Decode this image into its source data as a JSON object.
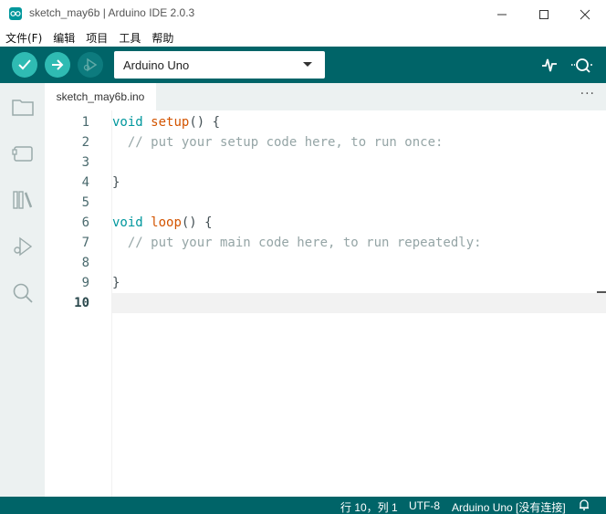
{
  "window": {
    "title": "sketch_may6b | Arduino IDE 2.0.3"
  },
  "menu": [
    "文件(F)",
    "编辑",
    "项目",
    "工具",
    "帮助"
  ],
  "toolbar": {
    "board": "Arduino Uno"
  },
  "editor": {
    "tab": "sketch_may6b.ino",
    "more": "···",
    "lines": [
      {
        "n": "1",
        "parts": [
          [
            "kw",
            "void"
          ],
          [
            "",
            " "
          ],
          [
            "fn",
            "setup"
          ],
          [
            "",
            "() {"
          ]
        ]
      },
      {
        "n": "2",
        "parts": [
          [
            "",
            "  "
          ],
          [
            "cm",
            "// put your setup code here, to run once:"
          ]
        ]
      },
      {
        "n": "3",
        "parts": []
      },
      {
        "n": "4",
        "parts": [
          [
            "",
            "}"
          ]
        ]
      },
      {
        "n": "5",
        "parts": []
      },
      {
        "n": "6",
        "parts": [
          [
            "kw",
            "void"
          ],
          [
            "",
            " "
          ],
          [
            "fn",
            "loop"
          ],
          [
            "",
            "() {"
          ]
        ]
      },
      {
        "n": "7",
        "parts": [
          [
            "",
            "  "
          ],
          [
            "cm",
            "// put your main code here, to run repeatedly:"
          ]
        ]
      },
      {
        "n": "8",
        "parts": []
      },
      {
        "n": "9",
        "parts": [
          [
            "",
            "}"
          ]
        ]
      },
      {
        "n": "10",
        "parts": []
      }
    ],
    "active_line": "10"
  },
  "status": {
    "position": "行 10，列 1",
    "encoding": "UTF-8",
    "board": "Arduino Uno [没有连接]"
  },
  "colors": {
    "teal_dark": "#006468",
    "teal_button": "#2fbbb3",
    "keyword": "#00979d",
    "function": "#d35400",
    "comment": "#95a5a6"
  }
}
